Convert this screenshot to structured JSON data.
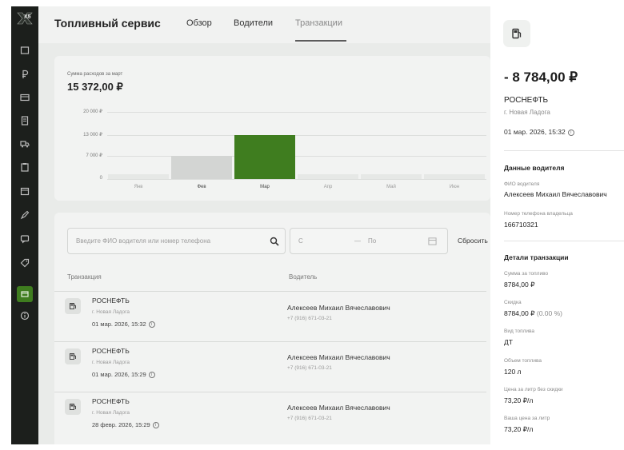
{
  "app": {
    "title": "Топливный сервис",
    "logo_text": "X5",
    "tabs": [
      {
        "label": "Обзор"
      },
      {
        "label": "Водители"
      },
      {
        "label": "Транзакции"
      }
    ]
  },
  "colors": {
    "accent": "#3f7d1f",
    "rail_bg": "#1c1f1c"
  },
  "spend_card": {
    "label": "Сумма расходов за март",
    "total": "15 372,00 ₽",
    "chart_data": {
      "type": "bar",
      "categories": [
        "Янв",
        "Фев",
        "Мар",
        "Апр",
        "Май",
        "Июн"
      ],
      "values": [
        0,
        7000,
        13000,
        0,
        0,
        0
      ],
      "highlighted": "Мар",
      "y_ticks": [
        "20 000 ₽",
        "13 000 ₽",
        "7 000 ₽",
        "0"
      ],
      "ylim": [
        0,
        20000
      ],
      "grid": true
    }
  },
  "filters": {
    "search_placeholder": "Введите ФИО водителя или номер телефона",
    "date_from": "С",
    "date_sep": "—",
    "date_to": "По",
    "reset_label": "Сбросить"
  },
  "table": {
    "columns": [
      "Транзакция",
      "Водитель"
    ],
    "rows": [
      {
        "brand": "РОСНЕФТЬ",
        "city": "г. Новая Ладога",
        "date": "01 мар. 2026, 15:32",
        "driver": "Алексеев Михаил Вячеславович",
        "phone": "+7 (916) 671-03-21"
      },
      {
        "brand": "РОСНЕФТЬ",
        "city": "г. Новая Ладога",
        "date": "01 мар. 2026, 15:29",
        "driver": "Алексеев Михаил Вячеславович",
        "phone": "+7 (916) 671-03-21"
      },
      {
        "brand": "РОСНЕФТЬ",
        "city": "г. Новая Ладога",
        "date": "28 февр. 2026, 15:29",
        "driver": "Алексеев Михаил Вячеславович",
        "phone": "+7 (916) 671-03-21"
      }
    ]
  },
  "panel": {
    "amount": "- 8 784,00 ₽",
    "brand": "РОСНЕФТЬ",
    "city": "г. Новая Ладога",
    "date": "01 мар. 2026, 15:32",
    "driver_section": {
      "title": "Данные водителя",
      "name_label": "ФИО водителя",
      "name_value": "Алексеев Михаил Вячеславович",
      "phone_label": "Номер телефона владельца",
      "phone_value": "166710321"
    },
    "tx_section": {
      "title": "Детали транзакции",
      "fields": [
        {
          "label": "Сумма за топливо",
          "value": "8784,00 ₽"
        },
        {
          "label": "Скидка",
          "value": "8784,00 ₽",
          "note": "(0.00 %)"
        },
        {
          "label": "Вид топлива",
          "value": "ДТ"
        },
        {
          "label": "Объем топлива",
          "value": "120 л"
        },
        {
          "label": "Цена за литр без скидки",
          "value": "73,20 ₽/л"
        },
        {
          "label": "Ваша цена за литр",
          "value": "73,20 ₽/л"
        }
      ]
    }
  }
}
